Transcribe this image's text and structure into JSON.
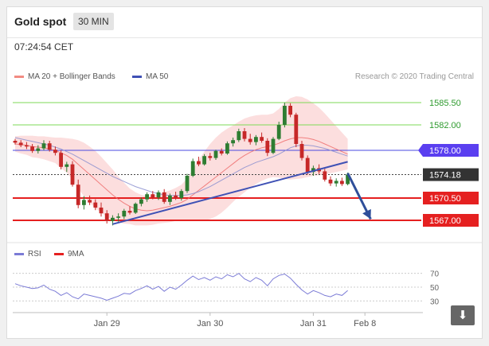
{
  "header": {
    "title": "Gold spot",
    "timeframe": "30 MIN"
  },
  "time": "07:24:54 CET",
  "legend": [
    {
      "label": "MA 20 + Bollinger Bands",
      "color": "#f28b82"
    },
    {
      "label": "MA 50",
      "color": "#3f51b5"
    }
  ],
  "copyright": "Research © 2020 Trading Central",
  "rsi_legend": [
    {
      "label": "RSI",
      "color": "#7b7bd6"
    },
    {
      "label": "9MA",
      "color": "#e52020"
    }
  ],
  "colors": {
    "up": "#2e7d32",
    "down": "#c62828",
    "resistance": "#7ed957",
    "support": "#e52020",
    "ma50": "#3f51b5"
  },
  "icons": {
    "download": "download-icon"
  },
  "chart_data": {
    "type": "candlestick",
    "ylim": [
      1564.5,
      1587.5
    ],
    "price_levels": [
      {
        "label": "1585.50",
        "value": 1585.5,
        "kind": "resistance"
      },
      {
        "label": "1582.00",
        "value": 1582.0,
        "kind": "resistance"
      },
      {
        "label": "1578.00",
        "value": 1578.0,
        "kind": "ma50"
      },
      {
        "label": "1574.18",
        "value": 1574.18,
        "kind": "last"
      },
      {
        "label": "1570.50",
        "value": 1570.5,
        "kind": "support"
      },
      {
        "label": "1567.00",
        "value": 1567.0,
        "kind": "support"
      }
    ],
    "x_labels": [
      {
        "label": "Jan 29",
        "index": 16
      },
      {
        "label": "Jan 30",
        "index": 34
      },
      {
        "label": "Jan 31",
        "index": 52
      },
      {
        "label": "Feb 8",
        "index": 61
      }
    ],
    "candles": [
      [
        1579.5,
        1579.8,
        1578.9,
        1579.2
      ],
      [
        1579.2,
        1579.6,
        1578.5,
        1578.8
      ],
      [
        1578.8,
        1579.3,
        1578.2,
        1578.6
      ],
      [
        1578.6,
        1579.0,
        1577.6,
        1577.9
      ],
      [
        1577.9,
        1578.8,
        1577.5,
        1578.3
      ],
      [
        1578.3,
        1579.6,
        1578.0,
        1579.1
      ],
      [
        1579.1,
        1579.5,
        1577.8,
        1578.1
      ],
      [
        1578.1,
        1578.6,
        1577.2,
        1577.6
      ],
      [
        1577.6,
        1578.0,
        1575.0,
        1575.4
      ],
      [
        1575.4,
        1576.2,
        1574.6,
        1575.8
      ],
      [
        1575.8,
        1576.3,
        1572.3,
        1572.6
      ],
      [
        1572.6,
        1573.4,
        1568.9,
        1569.4
      ],
      [
        1569.4,
        1570.8,
        1568.7,
        1570.2
      ],
      [
        1570.2,
        1570.9,
        1569.4,
        1569.8
      ],
      [
        1569.8,
        1570.3,
        1568.6,
        1569.0
      ],
      [
        1569.0,
        1569.8,
        1567.6,
        1568.1
      ],
      [
        1568.1,
        1568.6,
        1566.5,
        1566.9
      ],
      [
        1566.9,
        1567.8,
        1566.2,
        1567.4
      ],
      [
        1567.4,
        1568.1,
        1566.8,
        1567.6
      ],
      [
        1567.6,
        1568.8,
        1567.2,
        1568.5
      ],
      [
        1568.5,
        1569.2,
        1567.9,
        1568.2
      ],
      [
        1568.2,
        1569.8,
        1568.0,
        1569.6
      ],
      [
        1569.6,
        1570.6,
        1569.2,
        1570.3
      ],
      [
        1570.3,
        1571.4,
        1569.9,
        1571.1
      ],
      [
        1571.1,
        1571.6,
        1570.3,
        1570.6
      ],
      [
        1570.6,
        1571.7,
        1570.2,
        1571.4
      ],
      [
        1571.4,
        1571.9,
        1569.6,
        1569.9
      ],
      [
        1569.9,
        1571.2,
        1569.4,
        1570.9
      ],
      [
        1570.9,
        1571.5,
        1570.2,
        1570.5
      ],
      [
        1570.5,
        1571.9,
        1570.1,
        1571.6
      ],
      [
        1571.6,
        1574.3,
        1571.3,
        1574.0
      ],
      [
        1574.0,
        1576.7,
        1573.8,
        1576.3
      ],
      [
        1576.3,
        1577.0,
        1575.5,
        1575.8
      ],
      [
        1575.8,
        1577.4,
        1575.6,
        1577.1
      ],
      [
        1577.1,
        1577.6,
        1576.4,
        1576.8
      ],
      [
        1576.8,
        1578.1,
        1576.5,
        1577.9
      ],
      [
        1577.9,
        1578.3,
        1577.2,
        1577.5
      ],
      [
        1577.5,
        1579.4,
        1577.3,
        1579.1
      ],
      [
        1579.1,
        1580.0,
        1578.6,
        1579.6
      ],
      [
        1579.6,
        1581.4,
        1579.3,
        1581.0
      ],
      [
        1581.0,
        1581.5,
        1579.4,
        1579.8
      ],
      [
        1579.8,
        1580.6,
        1578.9,
        1579.3
      ],
      [
        1579.3,
        1580.4,
        1578.8,
        1580.1
      ],
      [
        1580.1,
        1580.8,
        1579.2,
        1579.5
      ],
      [
        1579.5,
        1579.9,
        1577.1,
        1577.6
      ],
      [
        1577.6,
        1580.1,
        1577.4,
        1579.8
      ],
      [
        1579.8,
        1582.5,
        1579.6,
        1582.0
      ],
      [
        1582.0,
        1585.5,
        1581.6,
        1585.0
      ],
      [
        1585.0,
        1585.4,
        1583.2,
        1583.6
      ],
      [
        1583.6,
        1583.9,
        1578.5,
        1579.0
      ],
      [
        1579.0,
        1579.5,
        1576.4,
        1576.8
      ],
      [
        1576.8,
        1577.2,
        1574.2,
        1574.6
      ],
      [
        1574.6,
        1575.6,
        1574.0,
        1575.2
      ],
      [
        1575.2,
        1575.8,
        1574.3,
        1574.7
      ],
      [
        1574.7,
        1575.1,
        1573.1,
        1573.4
      ],
      [
        1573.4,
        1573.9,
        1572.4,
        1572.8
      ],
      [
        1572.8,
        1573.6,
        1572.3,
        1573.2
      ],
      [
        1573.2,
        1573.7,
        1572.4,
        1572.7
      ],
      [
        1572.7,
        1574.5,
        1572.5,
        1574.2
      ]
    ],
    "ma20": [
      1579.0,
      1578.9,
      1578.8,
      1578.6,
      1578.5,
      1578.4,
      1578.2,
      1578.0,
      1577.6,
      1577.2,
      1576.6,
      1575.8,
      1575.0,
      1574.2,
      1573.4,
      1572.6,
      1571.8,
      1571.0,
      1570.3,
      1569.7,
      1569.2,
      1568.8,
      1568.6,
      1568.5,
      1568.6,
      1568.8,
      1569.0,
      1569.2,
      1569.5,
      1569.8,
      1570.3,
      1571.0,
      1571.7,
      1572.4,
      1573.1,
      1573.8,
      1574.5,
      1575.2,
      1575.9,
      1576.6,
      1577.2,
      1577.7,
      1578.1,
      1578.4,
      1578.6,
      1578.8,
      1579.1,
      1579.5,
      1579.8,
      1580.0,
      1580.0,
      1579.9,
      1579.7,
      1579.4,
      1579.0,
      1578.6,
      1578.2,
      1577.8,
      1577.4
    ],
    "boll_upper": [
      1580.2,
      1580.3,
      1580.3,
      1580.3,
      1580.2,
      1580.2,
      1580.1,
      1580.0,
      1580.0,
      1579.9,
      1579.8,
      1579.6,
      1579.2,
      1578.6,
      1577.9,
      1577.0,
      1576.0,
      1575.0,
      1573.9,
      1572.9,
      1572.0,
      1571.4,
      1571.0,
      1570.8,
      1570.9,
      1571.1,
      1571.4,
      1571.7,
      1572.1,
      1572.6,
      1573.6,
      1575.0,
      1576.5,
      1577.8,
      1579.0,
      1580.0,
      1580.8,
      1581.4,
      1581.9,
      1582.5,
      1583.0,
      1583.3,
      1583.5,
      1583.6,
      1583.6,
      1583.8,
      1584.5,
      1585.5,
      1586.2,
      1586.5,
      1586.4,
      1586.0,
      1585.4,
      1584.7,
      1583.8,
      1582.8,
      1581.8,
      1580.8,
      1579.8
    ],
    "boll_lower": [
      1577.8,
      1577.5,
      1577.3,
      1576.9,
      1576.8,
      1576.6,
      1576.3,
      1576.0,
      1575.2,
      1574.5,
      1573.4,
      1572.0,
      1570.8,
      1569.8,
      1568.9,
      1568.2,
      1567.6,
      1567.0,
      1566.7,
      1566.5,
      1566.4,
      1566.2,
      1566.2,
      1566.2,
      1566.3,
      1566.5,
      1566.6,
      1566.7,
      1566.9,
      1567.0,
      1567.0,
      1567.0,
      1566.9,
      1567.0,
      1567.2,
      1567.6,
      1568.2,
      1569.0,
      1569.9,
      1570.7,
      1571.4,
      1572.1,
      1572.7,
      1573.2,
      1573.6,
      1573.8,
      1573.7,
      1573.5,
      1573.4,
      1573.5,
      1573.6,
      1573.8,
      1574.0,
      1574.1,
      1574.2,
      1574.4,
      1574.6,
      1574.8,
      1575.0
    ],
    "ma50": [
      1580.0,
      1579.8,
      1579.6,
      1579.4,
      1579.2,
      1579.0,
      1578.8,
      1578.5,
      1578.2,
      1577.8,
      1577.4,
      1576.9,
      1576.4,
      1575.9,
      1575.4,
      1574.9,
      1574.4,
      1573.9,
      1573.5,
      1573.1,
      1572.7,
      1572.3,
      1572.0,
      1571.7,
      1571.4,
      1571.2,
      1571.0,
      1570.9,
      1570.9,
      1570.9,
      1571.0,
      1571.2,
      1571.5,
      1571.9,
      1572.3,
      1572.8,
      1573.3,
      1573.8,
      1574.3,
      1574.8,
      1575.3,
      1575.7,
      1576.1,
      1576.4,
      1576.7,
      1577.0,
      1577.4,
      1577.9,
      1578.4,
      1578.7,
      1578.8,
      1578.8,
      1578.7,
      1578.5,
      1578.3,
      1578.0,
      1577.7,
      1577.4,
      1577.1
    ],
    "trendline": {
      "from": [
        17,
        1566.4
      ],
      "to": [
        58,
        1576.2
      ]
    },
    "projection": {
      "from": [
        58,
        1574.4
      ],
      "to": [
        62,
        1567.2
      ]
    },
    "rsi": {
      "ylim": [
        20,
        80
      ],
      "levels": [
        {
          "label": "70",
          "value": 70
        },
        {
          "label": "50",
          "value": 50
        },
        {
          "label": "30",
          "value": 30
        }
      ],
      "values": [
        55,
        52,
        50,
        48,
        49,
        53,
        47,
        44,
        38,
        42,
        36,
        33,
        40,
        38,
        36,
        34,
        31,
        34,
        37,
        41,
        40,
        45,
        48,
        52,
        47,
        51,
        44,
        50,
        47,
        53,
        60,
        66,
        61,
        64,
        60,
        65,
        62,
        68,
        65,
        70,
        62,
        58,
        64,
        60,
        52,
        62,
        67,
        69,
        63,
        54,
        46,
        40,
        45,
        42,
        38,
        36,
        40,
        38,
        45
      ]
    }
  }
}
